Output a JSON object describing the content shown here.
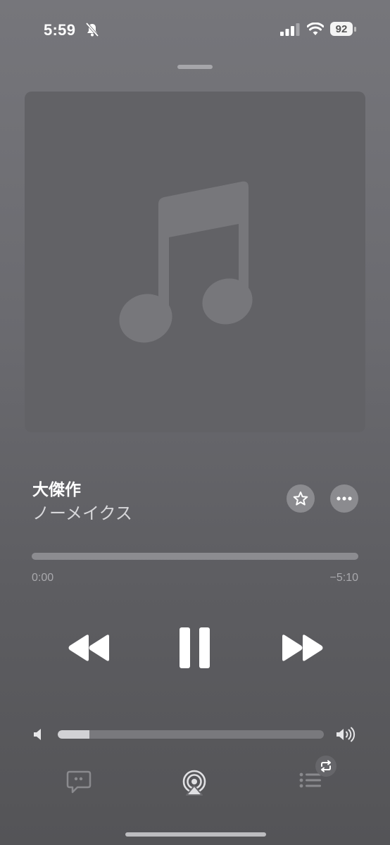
{
  "status_bar": {
    "time": "5:59",
    "battery_level": "92",
    "icons": [
      "bell-slash-icon",
      "cellular-signal-icon",
      "wifi-icon",
      "battery-icon"
    ]
  },
  "now_playing": {
    "artwork_icon": "music-note-icon",
    "title": "大傑作",
    "artist": "ノーメイクス",
    "progress": {
      "elapsed": "0:00",
      "remaining": "−5:10",
      "fraction": 0.0
    },
    "controls": {
      "rewind_icon": "backward-icon",
      "pause_icon": "pause-icon",
      "forward_icon": "forward-icon"
    },
    "volume": {
      "level": 0.12,
      "low_icon": "speaker-low-icon",
      "high_icon": "speaker-high-icon"
    },
    "actions": {
      "favorite_icon": "star-icon",
      "more_icon": "ellipsis-icon"
    }
  },
  "bottom_bar": {
    "lyrics_icon": "lyrics-bubble-icon",
    "airplay_icon": "airplay-icon",
    "queue_icon": "list-icon",
    "repeat_icon": "repeat-icon"
  },
  "colors": {
    "background": "#6e6e72",
    "artwork": "#626266",
    "text_primary": "#ffffff",
    "text_secondary": "#d7d7da"
  }
}
